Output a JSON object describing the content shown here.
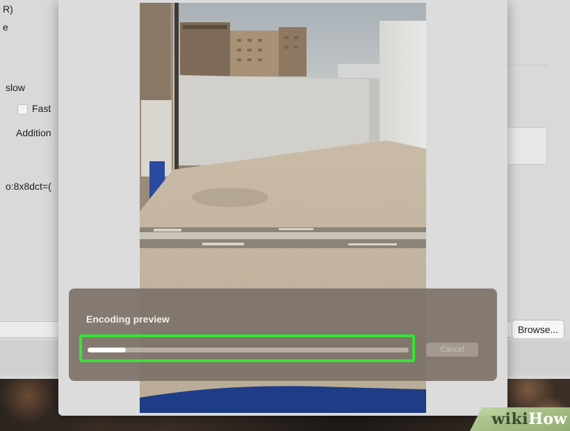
{
  "background_window": {
    "texts": {
      "line1": "R)",
      "line2": "e",
      "speed": "slow",
      "fast_decode": "Fast",
      "additional": "Addition",
      "options": "o:8x8dct=("
    },
    "browse_label": "Browse..."
  },
  "encoding": {
    "label": "Encoding preview",
    "progress": 0.12,
    "cancel_label": "Cancel"
  },
  "watermark": {
    "wiki": "wiki",
    "how": "How"
  },
  "colors": {
    "highlight": "#37e337",
    "hud": "#7d7268",
    "progress_fill": "#ffffff"
  }
}
